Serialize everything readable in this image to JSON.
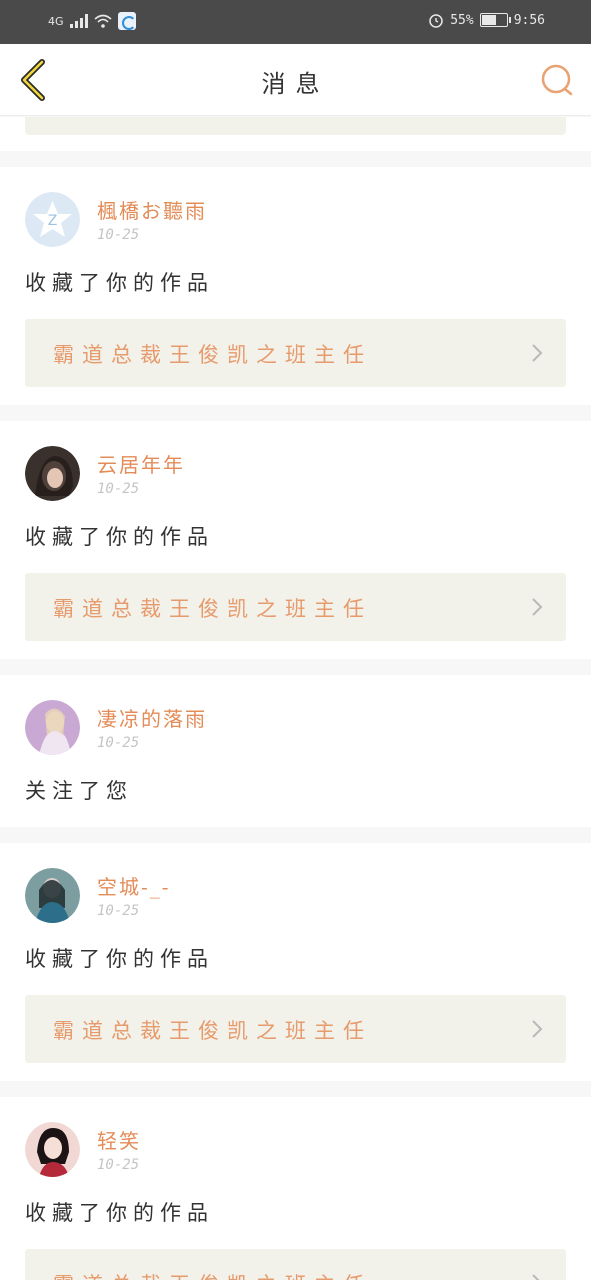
{
  "status_bar": {
    "network": "4G",
    "battery_percent": "55%",
    "battery_level": 0.55,
    "time": "9:56"
  },
  "header": {
    "title": "消息",
    "back_icon": "chevron-left-icon",
    "search_icon": "search-icon"
  },
  "colors": {
    "accent": "#e38c58",
    "card_bg": "#f2f2ea",
    "separator": "#f7f7f7"
  },
  "messages": [
    {
      "username": "楓橋お聽雨",
      "date": "10-25",
      "action": "收藏了你的作品",
      "work_title": "霸道总裁王俊凯之班主任",
      "avatar": "default-avatar"
    },
    {
      "username": "云居年年",
      "date": "10-25",
      "action": "收藏了你的作品",
      "work_title": "霸道总裁王俊凯之班主任",
      "avatar": "user-photo"
    },
    {
      "username": "凄凉的落雨",
      "date": "10-25",
      "action": "关注了您",
      "avatar": "user-photo"
    },
    {
      "username": "空城-_-",
      "date": "10-25",
      "action": "收藏了你的作品",
      "work_title": "霸道总裁王俊凯之班主任",
      "avatar": "user-photo"
    },
    {
      "username": "轻笑",
      "date": "10-25",
      "action": "收藏了你的作品",
      "work_title": "霸道总裁王俊凯之班主任",
      "avatar": "user-photo"
    }
  ]
}
